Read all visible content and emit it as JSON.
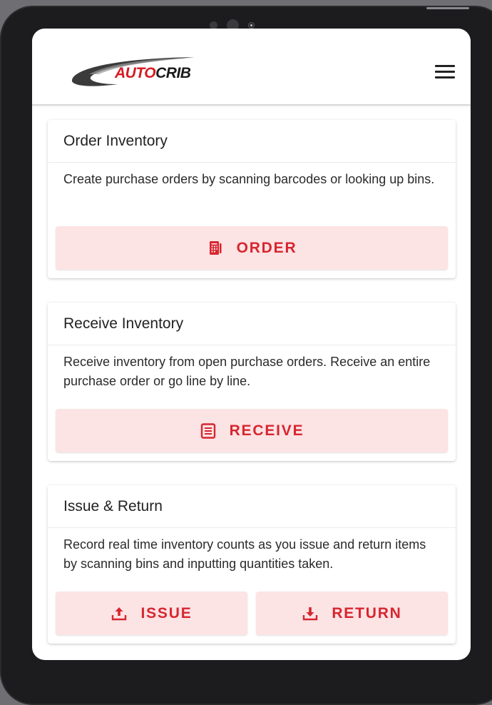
{
  "header": {
    "logo_text_auto": "AUTO",
    "logo_text_crib": "CRIB",
    "menu_icon": "hamburger-menu-icon"
  },
  "cards": [
    {
      "title": "Order Inventory",
      "description": "Create purchase orders by scanning barcodes or looking up bins.",
      "buttons": [
        {
          "label": "ORDER",
          "icon": "order-icon"
        }
      ]
    },
    {
      "title": "Receive Inventory",
      "description": "Receive inventory from open purchase orders. Receive an entire purchase order or go line by line.",
      "buttons": [
        {
          "label": "RECEIVE",
          "icon": "receipt-icon"
        }
      ]
    },
    {
      "title": "Issue & Return",
      "description": "Record real time inventory counts as you issue and return items by scanning bins and inputting quantities taken.",
      "buttons": [
        {
          "label": "ISSUE",
          "icon": "upload-icon"
        },
        {
          "label": "RETURN",
          "icon": "download-icon"
        }
      ]
    }
  ],
  "colors": {
    "accent": "#d72630",
    "button_bg": "#fce3e4",
    "brand_red": "#d71920"
  }
}
